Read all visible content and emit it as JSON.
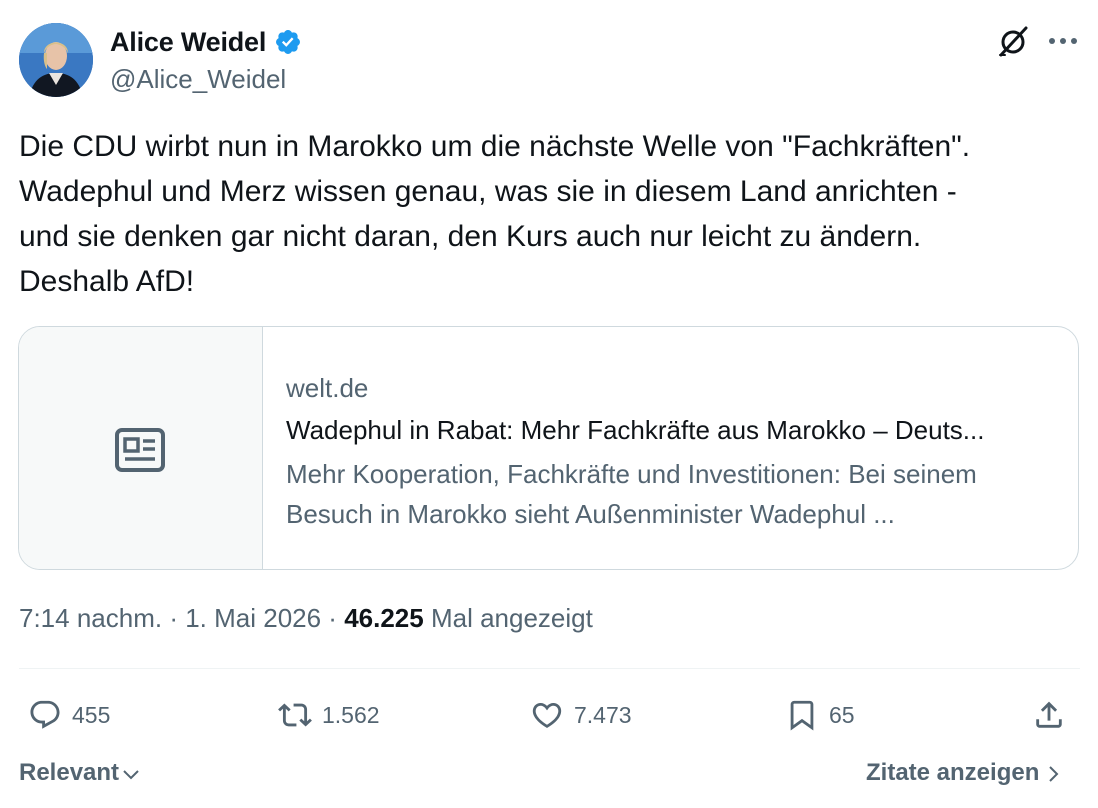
{
  "author": {
    "name": "Alice Weidel",
    "handle": "@Alice_Weidel",
    "verified": true
  },
  "tweet": {
    "lines": [
      "Die CDU wirbt nun in Marokko um die nächste Welle von \"Fachkräften\".",
      "Wadephul und Merz wissen genau, was sie in diesem Land anrichten -",
      "und sie denken gar nicht daran, den Kurs auch nur leicht zu ändern.",
      "Deshalb AfD!"
    ]
  },
  "card": {
    "media_icon": "news-article-icon",
    "domain": "welt.de",
    "title": "Wadephul in Rabat: Mehr Fachkräfte aus Marokko – Deuts...",
    "description_lines": [
      "Mehr Kooperation, Fachkräfte und Investitionen: Bei seinem",
      "Besuch in Marokko sieht Außenminister Wadephul ..."
    ]
  },
  "meta": {
    "time": "7:14 nachm.",
    "separator": " · ",
    "date": "1. Mai 2026",
    "views_count": "46.225",
    "views_label": "Mal angezeigt"
  },
  "actions": {
    "replies": "455",
    "reposts": "1.562",
    "likes": "7.473",
    "bookmarks": "65"
  },
  "footer": {
    "sort_label": "Relevant",
    "quotes_label": "Zitate anzeigen"
  },
  "colors": {
    "text_primary": "#0f1419",
    "text_secondary": "#536471",
    "verified": "#1d9bf0",
    "border": "#cfd9de"
  }
}
